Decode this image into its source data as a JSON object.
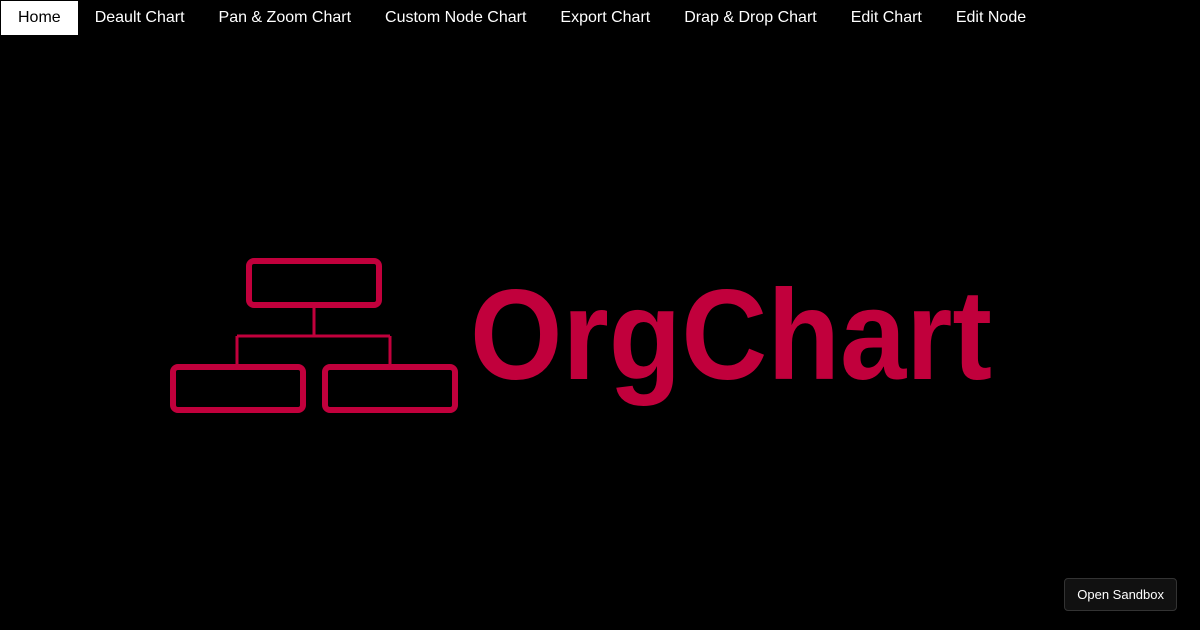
{
  "nav": {
    "items": [
      {
        "label": "Home",
        "active": true
      },
      {
        "label": "Deault Chart",
        "active": false
      },
      {
        "label": "Pan & Zoom Chart",
        "active": false
      },
      {
        "label": "Custom Node Chart",
        "active": false
      },
      {
        "label": "Export Chart",
        "active": false
      },
      {
        "label": "Drap & Drop Chart",
        "active": false
      },
      {
        "label": "Edit Chart",
        "active": false
      },
      {
        "label": "Edit Node",
        "active": false
      }
    ]
  },
  "logo": {
    "wordmark": "OrgChart",
    "icon": "org-tree-icon",
    "color": "#c1003c"
  },
  "sandbox": {
    "label": "Open Sandbox"
  },
  "colors": {
    "background": "#000000",
    "nav_text": "#ffffff",
    "active_bg": "#ffffff",
    "active_text": "#000000",
    "brand": "#c1003c"
  }
}
